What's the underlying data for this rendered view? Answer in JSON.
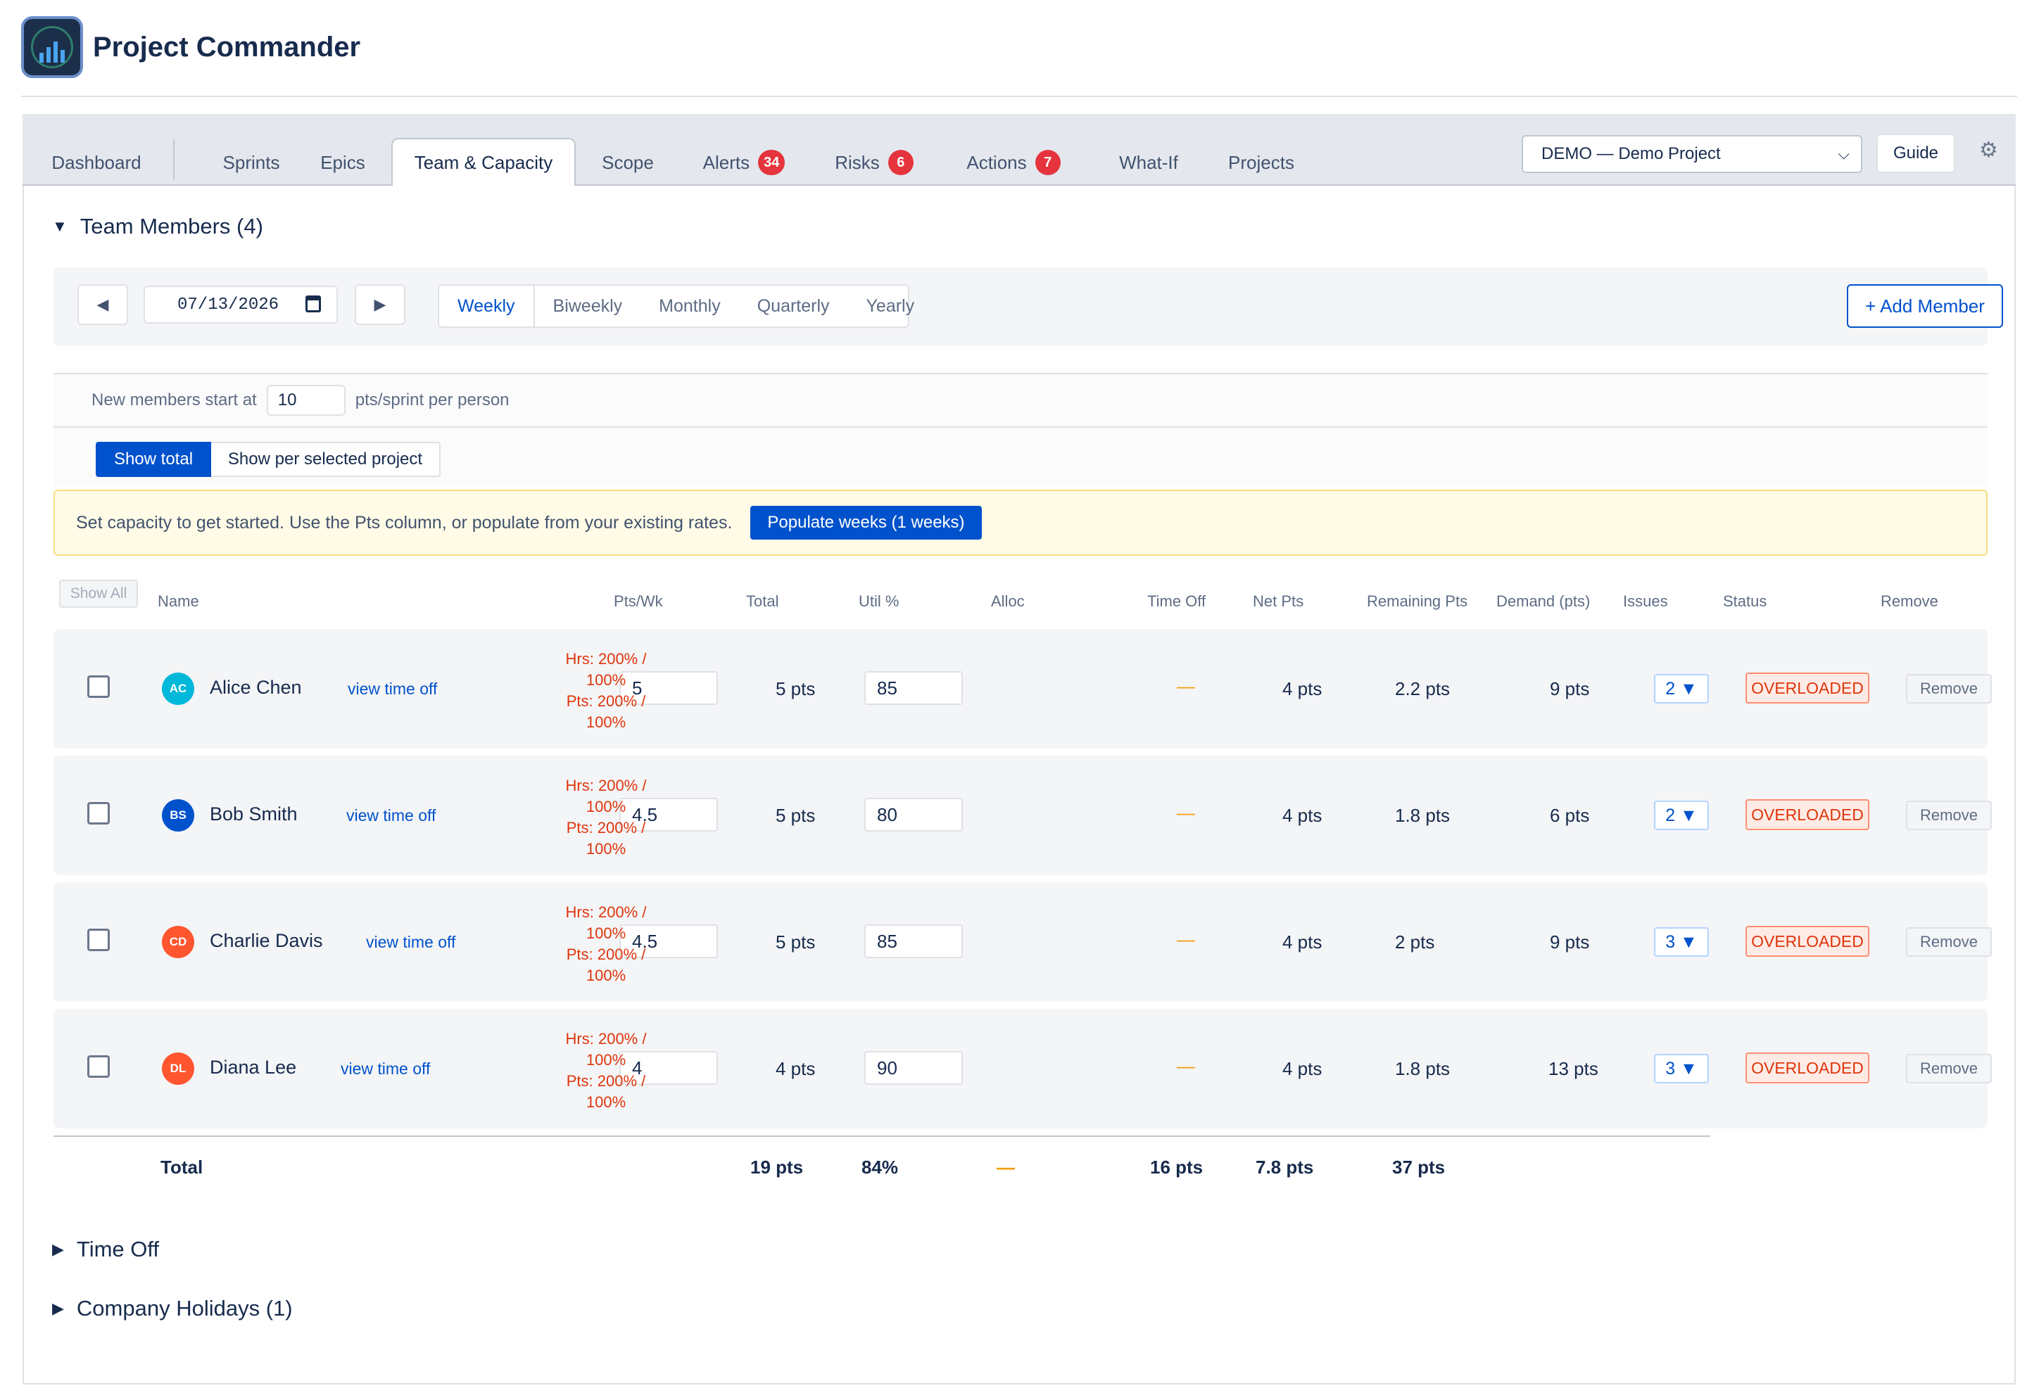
{
  "app": {
    "title": "Project Commander"
  },
  "tabs": [
    {
      "label": "Dashboard"
    },
    {
      "label": "Sprints"
    },
    {
      "label": "Epics"
    },
    {
      "label": "Team & Capacity"
    },
    {
      "label": "Scope"
    },
    {
      "label": "Alerts",
      "badge": "34"
    },
    {
      "label": "Risks",
      "badge": "6"
    },
    {
      "label": "Actions",
      "badge": "7"
    },
    {
      "label": "What-If"
    },
    {
      "label": "Projects"
    }
  ],
  "active_tab": "Team & Capacity",
  "header_controls": {
    "project_select": "DEMO — Demo Project",
    "guide_label": "Guide"
  },
  "team_section": {
    "title": "Team Members (4)",
    "date": "07/13/2026",
    "periods": [
      "Weekly",
      "Biweekly",
      "Monthly",
      "Quarterly",
      "Yearly"
    ],
    "active_period": "Weekly",
    "add_member_label": "+ Add Member",
    "new_members_prefix": "New members start at",
    "new_members_value": "10",
    "new_members_suffix": "pts/sprint per person",
    "view_total_label": "Show total",
    "view_project_label": "Show per selected project",
    "notice_text": "Set capacity to get started. Use the Pts column, or populate from your existing rates.",
    "populate_label": "Populate weeks (1 weeks)",
    "show_all_label": "Show All"
  },
  "table": {
    "headers": {
      "name": "Name",
      "pts_wk": "Pts/Wk",
      "total": "Total",
      "util": "Util %",
      "alloc": "Alloc",
      "time_off": "Time Off",
      "net_pts": "Net Pts",
      "remaining": "Remaining Pts",
      "demand": "Demand (pts)",
      "issues": "Issues",
      "status": "Status",
      "remove": "Remove"
    },
    "rows": [
      {
        "initials": "AC",
        "avatar_color": "#00b8d9",
        "name": "Alice Chen",
        "view_time_off": "view time off",
        "pts_wk": "5",
        "total": "5 pts",
        "util": "85",
        "alloc_hrs": "Hrs: 200% /",
        "alloc_hrs2": "100%",
        "alloc_pts": "Pts: 200% /",
        "alloc_pts2": "100%",
        "time_off": "—",
        "net_pts": "4 pts",
        "remaining": "2.2 pts",
        "demand": "9 pts",
        "issues": "2 ▼",
        "status": "OVERLOADED",
        "remove": "Remove"
      },
      {
        "initials": "BS",
        "avatar_color": "#0052cc",
        "name": "Bob Smith",
        "view_time_off": "view time off",
        "pts_wk": "4.5",
        "total": "5 pts",
        "util": "80",
        "alloc_hrs": "Hrs: 200% /",
        "alloc_hrs2": "100%",
        "alloc_pts": "Pts: 200% /",
        "alloc_pts2": "100%",
        "time_off": "—",
        "net_pts": "4 pts",
        "remaining": "1.8 pts",
        "demand": "6 pts",
        "issues": "2 ▼",
        "status": "OVERLOADED",
        "remove": "Remove"
      },
      {
        "initials": "CD",
        "avatar_color": "#ff5630",
        "name": "Charlie Davis",
        "view_time_off": "view time off",
        "pts_wk": "4.5",
        "total": "5 pts",
        "util": "85",
        "alloc_hrs": "Hrs: 200% /",
        "alloc_hrs2": "100%",
        "alloc_pts": "Pts: 200% /",
        "alloc_pts2": "100%",
        "time_off": "—",
        "net_pts": "4 pts",
        "remaining": "2 pts",
        "demand": "9 pts",
        "issues": "3 ▼",
        "status": "OVERLOADED",
        "remove": "Remove"
      },
      {
        "initials": "DL",
        "avatar_color": "#ff5630",
        "name": "Diana Lee",
        "view_time_off": "view time off",
        "pts_wk": "4",
        "total": "4 pts",
        "util": "90",
        "alloc_hrs": "Hrs: 200% /",
        "alloc_hrs2": "100%",
        "alloc_pts": "Pts: 200% /",
        "alloc_pts2": "100%",
        "time_off": "—",
        "net_pts": "4 pts",
        "remaining": "1.8 pts",
        "demand": "13 pts",
        "issues": "3 ▼",
        "status": "OVERLOADED",
        "remove": "Remove"
      }
    ],
    "totals": {
      "label": "Total",
      "total": "19 pts",
      "util": "84%",
      "alloc": "—",
      "time_off": "16 pts",
      "net_pts": "7.8 pts",
      "remaining": "37 pts"
    }
  },
  "collapsed_sections": [
    {
      "title": "Time Off"
    },
    {
      "title": "Company Holidays (1)"
    }
  ],
  "colors": {
    "accent": "#0052cc",
    "danger": "#de350b",
    "badge": "#e5343d",
    "warning_bg": "#fffbe6"
  }
}
